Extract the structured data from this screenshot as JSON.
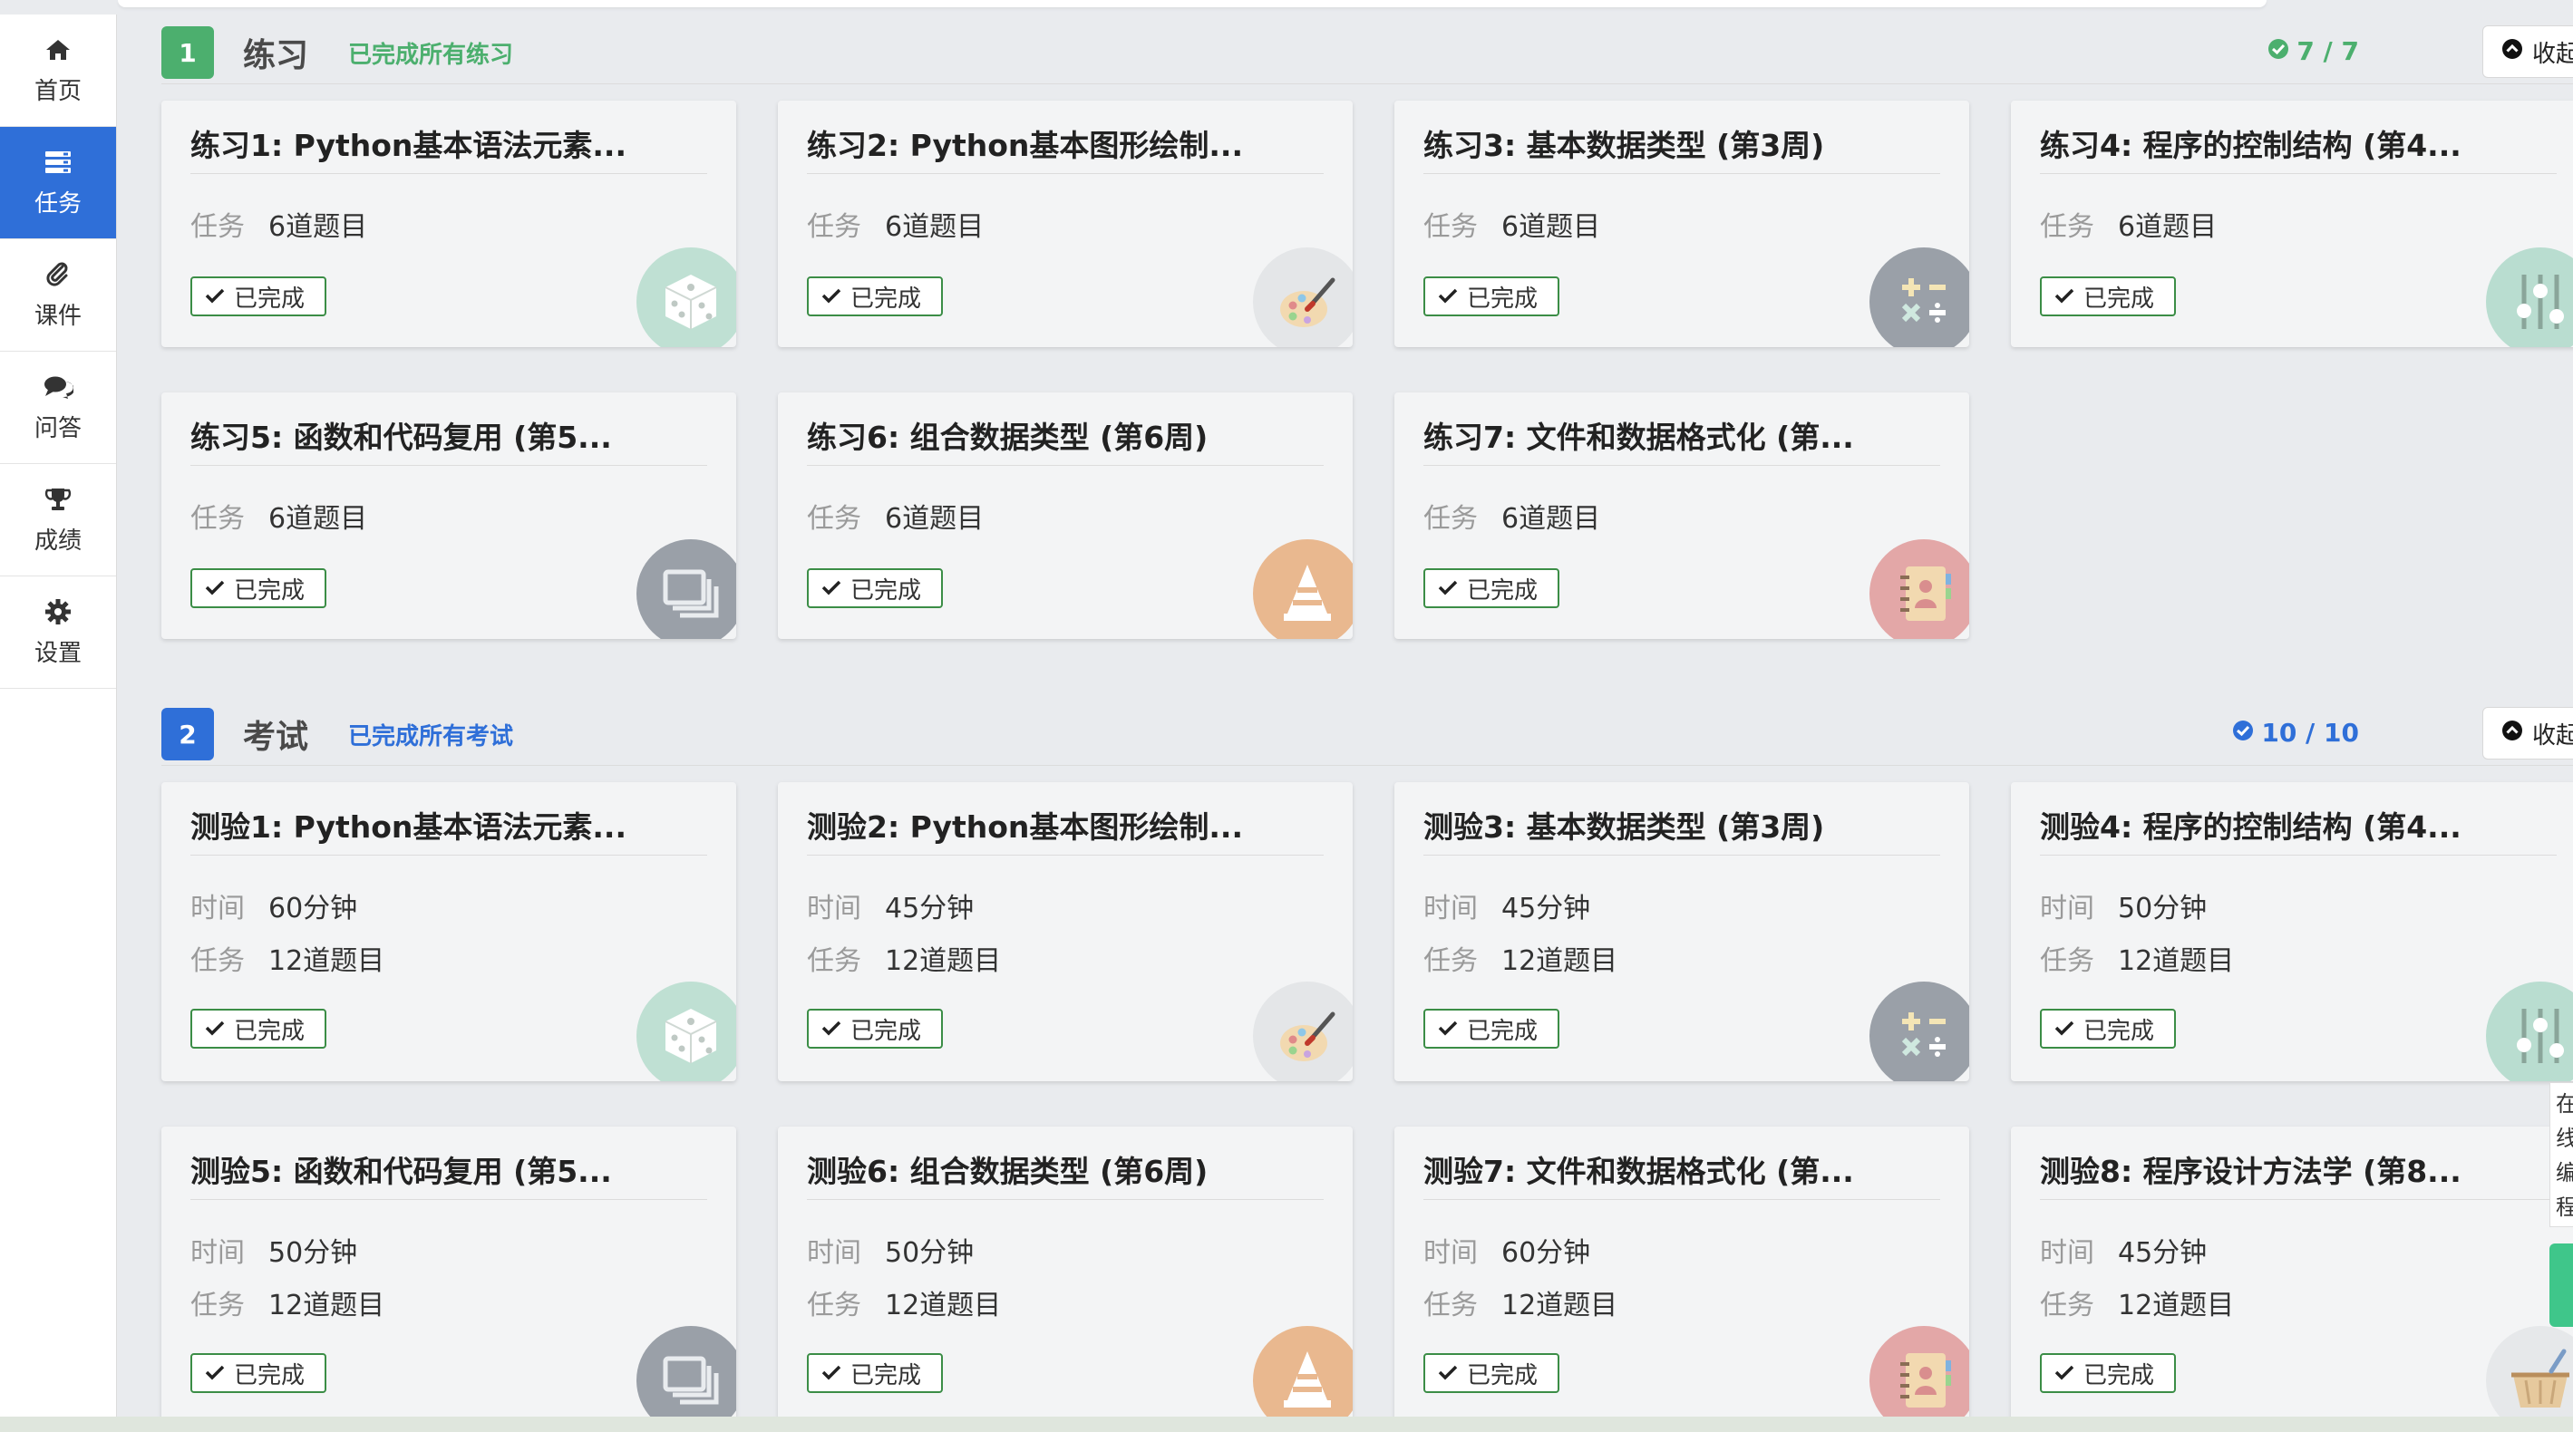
{
  "nav": [
    {
      "label": "首页",
      "icon": "home-icon",
      "name": "nav-home",
      "active": false
    },
    {
      "label": "任务",
      "icon": "tasks-icon",
      "name": "nav-tasks",
      "active": true
    },
    {
      "label": "课件",
      "icon": "paperclip-icon",
      "name": "nav-courseware",
      "active": false
    },
    {
      "label": "问答",
      "icon": "comments-icon",
      "name": "nav-qa",
      "active": false
    },
    {
      "label": "成绩",
      "icon": "trophy-icon",
      "name": "nav-grades",
      "active": false
    },
    {
      "label": "设置",
      "icon": "gear-icon",
      "name": "nav-settings",
      "active": false
    }
  ],
  "sections": [
    {
      "number": "1",
      "title": "练习",
      "note": "已完成所有练习",
      "count": "7 / 7",
      "collapse": "收起",
      "accent": "#4caf6e",
      "cards": [
        {
          "title": "练习1: Python基本语法元素...",
          "rows": [
            {
              "k": "任务",
              "v": "6道题目"
            }
          ],
          "status": "已完成",
          "icon": "dice-icon"
        },
        {
          "title": "练习2: Python基本图形绘制...",
          "rows": [
            {
              "k": "任务",
              "v": "6道题目"
            }
          ],
          "status": "已完成",
          "icon": "palette-icon"
        },
        {
          "title": "练习3: 基本数据类型 (第3周)",
          "rows": [
            {
              "k": "任务",
              "v": "6道题目"
            }
          ],
          "status": "已完成",
          "icon": "calculator-icon"
        },
        {
          "title": "练习4: 程序的控制结构 (第4...",
          "rows": [
            {
              "k": "任务",
              "v": "6道题目"
            }
          ],
          "status": "已完成",
          "icon": "sliders-icon"
        },
        {
          "title": "练习5: 函数和代码复用 (第5...",
          "rows": [
            {
              "k": "任务",
              "v": "6道题目"
            }
          ],
          "status": "已完成",
          "icon": "windows-icon"
        },
        {
          "title": "练习6: 组合数据类型 (第6周)",
          "rows": [
            {
              "k": "任务",
              "v": "6道题目"
            }
          ],
          "status": "已完成",
          "icon": "cone-icon"
        },
        {
          "title": "练习7: 文件和数据格式化 (第...",
          "rows": [
            {
              "k": "任务",
              "v": "6道题目"
            }
          ],
          "status": "已完成",
          "icon": "address-book-icon"
        }
      ]
    },
    {
      "number": "2",
      "title": "考试",
      "note": "已完成所有考试",
      "count": "10 / 10",
      "collapse": "收起",
      "accent": "#2f6fd8",
      "cards": [
        {
          "title": "测验1: Python基本语法元素...",
          "rows": [
            {
              "k": "时间",
              "v": "60分钟"
            },
            {
              "k": "任务",
              "v": "12道题目"
            }
          ],
          "status": "已完成",
          "icon": "dice-icon"
        },
        {
          "title": "测验2: Python基本图形绘制...",
          "rows": [
            {
              "k": "时间",
              "v": "45分钟"
            },
            {
              "k": "任务",
              "v": "12道题目"
            }
          ],
          "status": "已完成",
          "icon": "palette-icon"
        },
        {
          "title": "测验3: 基本数据类型 (第3周)",
          "rows": [
            {
              "k": "时间",
              "v": "45分钟"
            },
            {
              "k": "任务",
              "v": "12道题目"
            }
          ],
          "status": "已完成",
          "icon": "calculator-icon"
        },
        {
          "title": "测验4: 程序的控制结构 (第4...",
          "rows": [
            {
              "k": "时间",
              "v": "50分钟"
            },
            {
              "k": "任务",
              "v": "12道题目"
            }
          ],
          "status": "已完成",
          "icon": "sliders-icon"
        },
        {
          "title": "测验5: 函数和代码复用 (第5...",
          "rows": [
            {
              "k": "时间",
              "v": "50分钟"
            },
            {
              "k": "任务",
              "v": "12道题目"
            }
          ],
          "status": "已完成",
          "icon": "windows-icon"
        },
        {
          "title": "测验6: 组合数据类型 (第6周)",
          "rows": [
            {
              "k": "时间",
              "v": "50分钟"
            },
            {
              "k": "任务",
              "v": "12道题目"
            }
          ],
          "status": "已完成",
          "icon": "cone-icon"
        },
        {
          "title": "测验7: 文件和数据格式化 (第...",
          "rows": [
            {
              "k": "时间",
              "v": "60分钟"
            },
            {
              "k": "任务",
              "v": "12道题目"
            }
          ],
          "status": "已完成",
          "icon": "address-book-icon"
        },
        {
          "title": "测验8: 程序设计方法学 (第8...",
          "rows": [
            {
              "k": "时间",
              "v": "45分钟"
            },
            {
              "k": "任务",
              "v": "12道题目"
            }
          ],
          "status": "已完成",
          "icon": "basket-icon"
        }
      ]
    }
  ],
  "side_panel": {
    "text": "在线编程"
  }
}
